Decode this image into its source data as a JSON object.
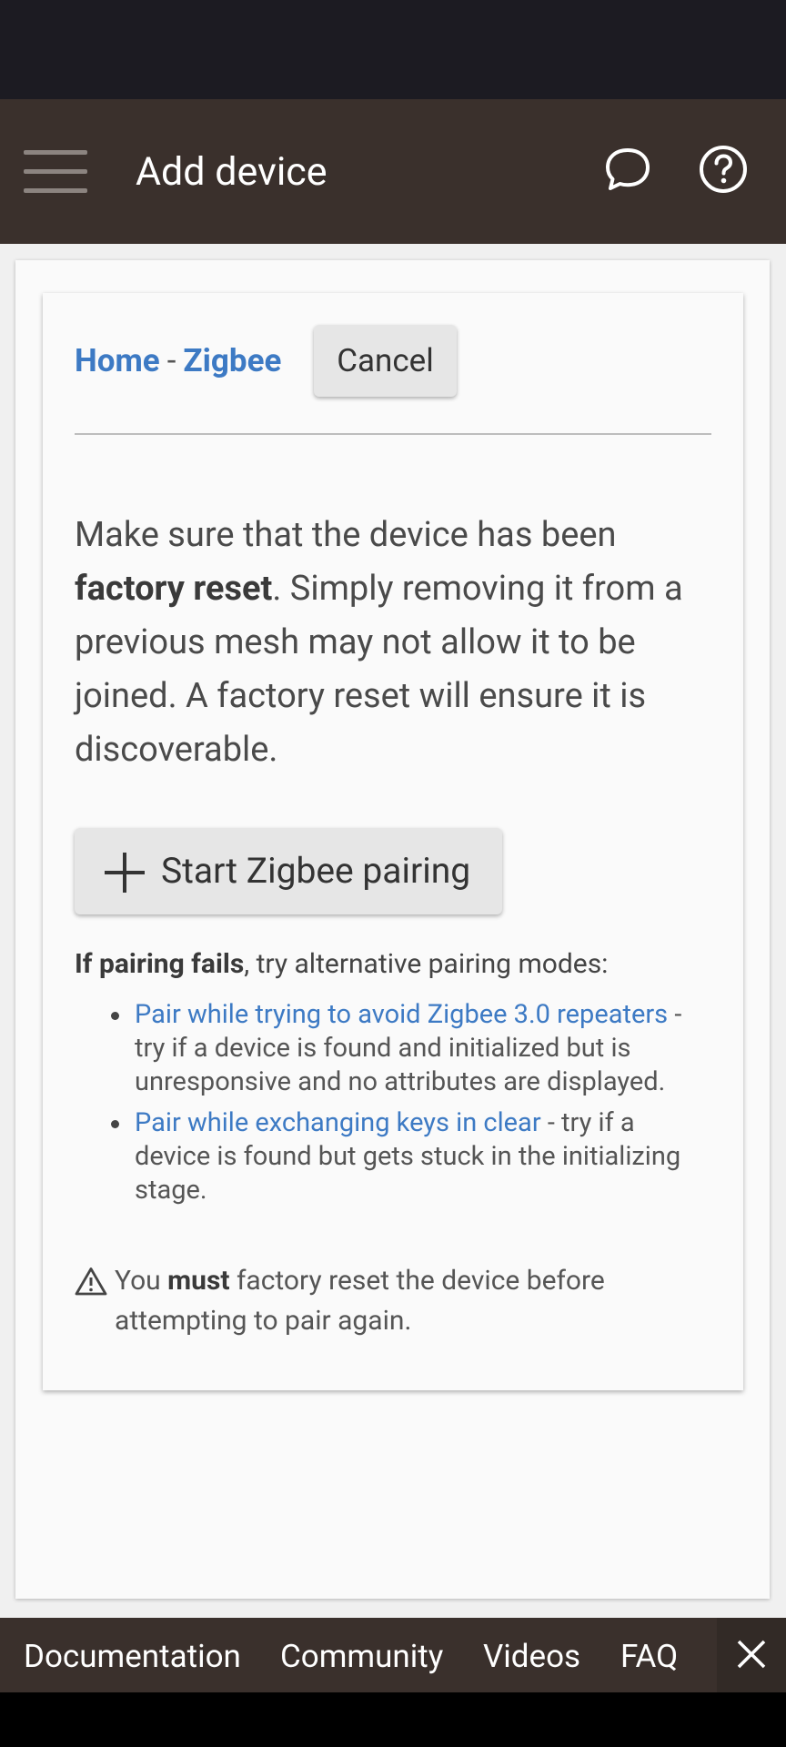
{
  "app_bar": {
    "title": "Add device",
    "icons": [
      "menu-icon",
      "chat-icon",
      "help-icon"
    ]
  },
  "breadcrumb": {
    "home": "Home",
    "separator": "-",
    "current": "Zigbee"
  },
  "cancel_label": "Cancel",
  "intro": {
    "part1": "Make sure that the device has been ",
    "bold": "factory reset",
    "part2": ". Simply removing it from a previous mesh may not allow it to be joined. A factory reset will ensure it is discoverable."
  },
  "pair_button_label": "Start Zigbee pairing",
  "fails": {
    "bold": "If pairing fails",
    "rest": ", try alternative pairing modes:"
  },
  "alternatives": [
    {
      "link": "Pair while trying to avoid Zigbee 3.0 repeaters",
      "desc": " - try if a device is found and initialized but is unresponsive and no attributes are displayed."
    },
    {
      "link": "Pair while exchanging keys in clear",
      "desc": " - try if a device is found but gets stuck in the initializing stage."
    }
  ],
  "warning": {
    "pre": "You ",
    "bold": "must",
    "post": " factory reset the device before attempting to pair again."
  },
  "footer_links": {
    "documentation": "Documentation",
    "community": "Community",
    "videos": "Videos",
    "faq": "FAQ"
  },
  "colors": {
    "app_bar": "#3a302c",
    "status_bar": "#1c1b22",
    "link": "#3d7ac4",
    "card": "#fafafa"
  }
}
